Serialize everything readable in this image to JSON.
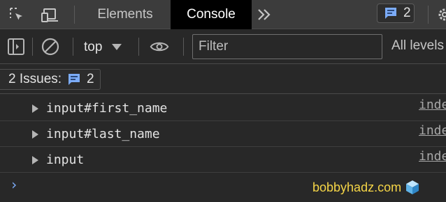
{
  "tabbar": {
    "tabs": [
      {
        "label": "Elements",
        "active": false
      },
      {
        "label": "Console",
        "active": true
      }
    ],
    "issues_count": "2"
  },
  "toolbar": {
    "context": "top",
    "filter_placeholder": "Filter",
    "levels": "All levels"
  },
  "issues": {
    "label": "2 Issues:",
    "count": "2"
  },
  "messages": [
    {
      "text": "input#first_name",
      "source": "index"
    },
    {
      "text": "input#last_name",
      "source": "index"
    },
    {
      "text": "input",
      "source": "index"
    }
  ],
  "watermark": "bobbyhadz.com",
  "colors": {
    "accent_blue": "#7cacf8",
    "active_tab_bg": "#000000",
    "watermark": "#f5d547"
  }
}
